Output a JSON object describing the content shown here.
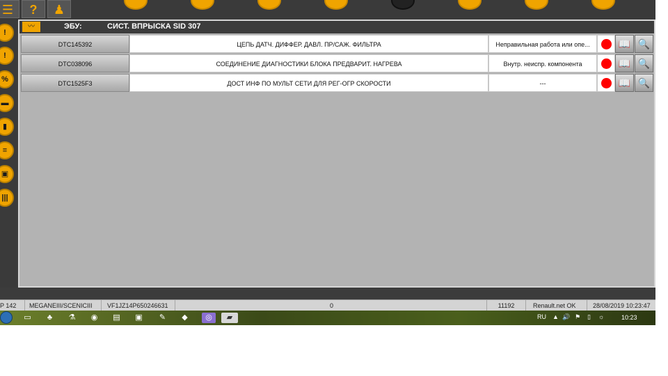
{
  "toolbar": {
    "buttons": [
      {
        "icon": "menu-list-icon",
        "glyph": "☰"
      },
      {
        "icon": "help-icon",
        "glyph": "?"
      },
      {
        "icon": "vehicle-person-icon",
        "glyph": "♟"
      },
      {
        "icon": "vehicle-front-icon"
      },
      {
        "icon": "bus-icon"
      },
      {
        "icon": "shield-icon"
      },
      {
        "icon": "card-icon"
      },
      {
        "icon": "gauge-icon"
      },
      {
        "icon": "phone-icon"
      },
      {
        "icon": "sound-icon"
      },
      {
        "icon": "car-icon"
      }
    ],
    "accent": "#f0a400"
  },
  "sidebar": {
    "icons": [
      {
        "name": "warning-icon",
        "glyph": "!"
      },
      {
        "name": "warning-icon",
        "glyph": "!"
      },
      {
        "name": "percent-icon",
        "glyph": "%"
      },
      {
        "name": "car-icon",
        "glyph": "▬"
      },
      {
        "name": "book-icon",
        "glyph": "▮"
      },
      {
        "name": "wiring-icon",
        "glyph": "≡"
      },
      {
        "name": "component-icon",
        "glyph": "▣"
      },
      {
        "name": "barcode-icon",
        "glyph": "|||"
      }
    ]
  },
  "ecu": {
    "label": "ЭБУ:",
    "value": "СИСТ. ВПРЫСКА SID 307"
  },
  "faults": [
    {
      "code": "DTC145392",
      "description": "ЦЕПЬ ДАТЧ. ДИФФЕР. ДАВЛ. ПР/САЖ. ФИЛЬТРА",
      "status": "Неправильная работа или опе...",
      "indicator": "#ff0000"
    },
    {
      "code": "DTC038096",
      "description": "СОЕДИНЕНИЕ ДИАГНОСТИКИ БЛОКА ПРЕДВАРИТ. НАГРЕВА",
      "status": "Внутр. неиспр. компонента",
      "indicator": "#ff0000"
    },
    {
      "code": "DTC1525F3",
      "description": "ДОСТ ИНФ ПО МУЛЬТ СЕТИ ДЛЯ РЕГ-ОГР СКОРОСТИ",
      "status": "---",
      "indicator": "#ff0000"
    }
  ],
  "statusbar": {
    "version": "P 142",
    "vehicle": "MEGANEIII/SCENICIII",
    "vin": "VF1JZ14P650246631",
    "counter": "0",
    "id": "11192",
    "network": "Renault.net OK",
    "datetime": "28/08/2019 10:23:47"
  },
  "taskbar": {
    "language": "RU",
    "time": "10:23",
    "apps": [
      "explorer-icon",
      "leaf-icon",
      "flask-icon",
      "chrome-icon",
      "notepad-icon",
      "folder-icon",
      "tool-icon",
      "car-app-icon",
      "viber-icon",
      "diag-app-icon"
    ]
  }
}
